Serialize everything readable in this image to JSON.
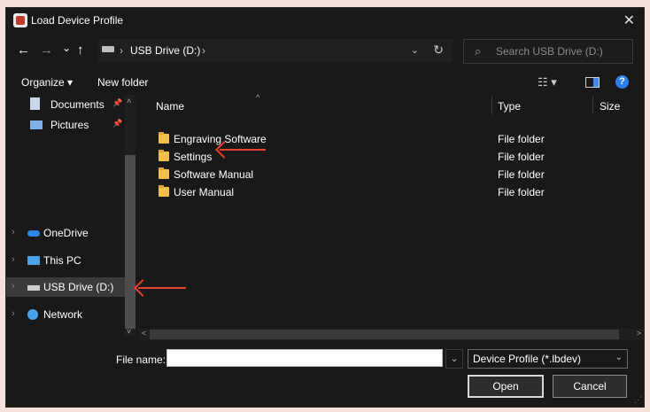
{
  "window": {
    "title": "Load Device Profile",
    "close_glyph": "✕"
  },
  "nav": {
    "back": "←",
    "forward": "→",
    "recent": "⌄",
    "up": "↑",
    "breadcrumb": {
      "sep1": "›",
      "drive": "USB Drive (D:)",
      "sep2": "›"
    },
    "dropdown": "⌄",
    "refresh": "↻",
    "search_placeholder": "Search USB Drive (D:)",
    "search_glyph": "⌕"
  },
  "toolbar": {
    "organize": "Organize ▾",
    "new_folder": "New folder",
    "views": "☷ ▾",
    "help": "?"
  },
  "sidebar": {
    "items": [
      {
        "label": "Documents",
        "icon": "documents-icon",
        "pin": "📌",
        "expander": ""
      },
      {
        "label": "Pictures",
        "icon": "pictures-icon",
        "pin": "📌",
        "expander": ""
      },
      {
        "label": "OneDrive",
        "icon": "onedrive-icon",
        "pin": "",
        "expander": "›"
      },
      {
        "label": "This PC",
        "icon": "this-pc-icon",
        "pin": "",
        "expander": "›"
      },
      {
        "label": "USB Drive (D:)",
        "icon": "usb-drive-icon",
        "pin": "",
        "expander": "›"
      },
      {
        "label": "Network",
        "icon": "network-icon",
        "pin": "",
        "expander": "›"
      }
    ],
    "selected": "USB Drive (D:)",
    "scroll_up": "˄",
    "scroll_down": "˅"
  },
  "files": {
    "columns": {
      "name": "Name",
      "type": "Type",
      "size": "Size",
      "sort": "^"
    },
    "rows": [
      {
        "name": "Engraving Software",
        "type": "File folder"
      },
      {
        "name": "Settings",
        "type": "File folder"
      },
      {
        "name": "Software Manual",
        "type": "File folder"
      },
      {
        "name": "User Manual",
        "type": "File folder"
      }
    ]
  },
  "hscroll": {
    "left": "<",
    "right": ">"
  },
  "footer": {
    "filename_label": "File name:",
    "filename_value": "",
    "dropdown_glyph": "⌄",
    "filter_value": "Device Profile (*.lbdev)",
    "filter_chevron": "⌄",
    "open_label": "Open",
    "cancel_label": "Cancel",
    "resize_glyph": "⋰"
  },
  "colors": {
    "accent": "#e4452a",
    "folder": "#f2c14b",
    "background": "#191919"
  }
}
